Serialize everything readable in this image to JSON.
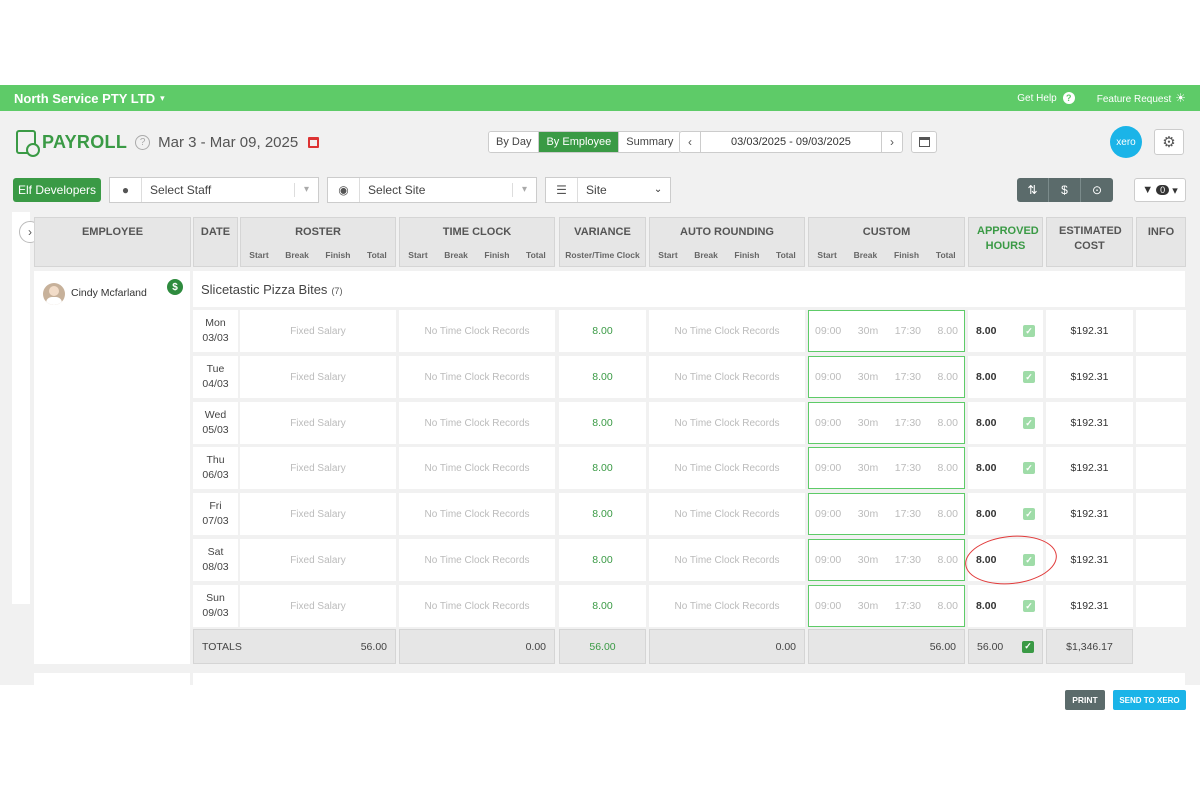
{
  "topbar": {
    "company": "North Service PTY LTD",
    "get_help": "Get Help",
    "feature_request": "Feature Request"
  },
  "header": {
    "title": "PAYROLL",
    "date_range_title": "Mar 3 - Mar 09, 2025",
    "views": [
      "By Day",
      "By Employee",
      "Summary"
    ],
    "active_view": "By Employee",
    "date_range": "03/03/2025 - 09/03/2025",
    "xero_label": "xero"
  },
  "filters": {
    "team": "Elf Developers",
    "staff_placeholder": "Select Staff",
    "site_placeholder": "Select Site",
    "group_by": "Site",
    "filter_count": "0"
  },
  "columns": {
    "employee": "EMPLOYEE",
    "date": "DATE",
    "roster": "ROSTER",
    "time_clock": "TIME CLOCK",
    "variance": "VARIANCE",
    "variance_sub": "Roster/Time Clock",
    "auto_rounding": "AUTO ROUNDING",
    "custom": "CUSTOM",
    "approved": "APPROVED HOURS",
    "cost": "ESTIMATED COST",
    "info": "INFO",
    "sub_start": "Start",
    "sub_break": "Break",
    "sub_finish": "Finish",
    "sub_total": "Total"
  },
  "employee": {
    "name": "Cindy Mcfarland",
    "site": "Slicetastic Pizza Bites",
    "site_count": "(7)"
  },
  "rows": [
    {
      "day": "Mon",
      "date": "03/03",
      "roster": "Fixed Salary",
      "clock": "No Time Clock Records",
      "variance": "8.00",
      "rounding": "No Time Clock Records",
      "c_start": "09:00",
      "c_break": "30m",
      "c_finish": "17:30",
      "c_total": "8.00",
      "approved": "8.00",
      "cost": "$192.31"
    },
    {
      "day": "Tue",
      "date": "04/03",
      "roster": "Fixed Salary",
      "clock": "No Time Clock Records",
      "variance": "8.00",
      "rounding": "No Time Clock Records",
      "c_start": "09:00",
      "c_break": "30m",
      "c_finish": "17:30",
      "c_total": "8.00",
      "approved": "8.00",
      "cost": "$192.31"
    },
    {
      "day": "Wed",
      "date": "05/03",
      "roster": "Fixed Salary",
      "clock": "No Time Clock Records",
      "variance": "8.00",
      "rounding": "No Time Clock Records",
      "c_start": "09:00",
      "c_break": "30m",
      "c_finish": "17:30",
      "c_total": "8.00",
      "approved": "8.00",
      "cost": "$192.31"
    },
    {
      "day": "Thu",
      "date": "06/03",
      "roster": "Fixed Salary",
      "clock": "No Time Clock Records",
      "variance": "8.00",
      "rounding": "No Time Clock Records",
      "c_start": "09:00",
      "c_break": "30m",
      "c_finish": "17:30",
      "c_total": "8.00",
      "approved": "8.00",
      "cost": "$192.31"
    },
    {
      "day": "Fri",
      "date": "07/03",
      "roster": "Fixed Salary",
      "clock": "No Time Clock Records",
      "variance": "8.00",
      "rounding": "No Time Clock Records",
      "c_start": "09:00",
      "c_break": "30m",
      "c_finish": "17:30",
      "c_total": "8.00",
      "approved": "8.00",
      "cost": "$192.31"
    },
    {
      "day": "Sat",
      "date": "08/03",
      "roster": "Fixed Salary",
      "clock": "No Time Clock Records",
      "variance": "8.00",
      "rounding": "No Time Clock Records",
      "c_start": "09:00",
      "c_break": "30m",
      "c_finish": "17:30",
      "c_total": "8.00",
      "approved": "8.00",
      "cost": "$192.31"
    },
    {
      "day": "Sun",
      "date": "09/03",
      "roster": "Fixed Salary",
      "clock": "No Time Clock Records",
      "variance": "8.00",
      "rounding": "No Time Clock Records",
      "c_start": "09:00",
      "c_break": "30m",
      "c_finish": "17:30",
      "c_total": "8.00",
      "approved": "8.00",
      "cost": "$192.31"
    }
  ],
  "totals": {
    "label": "TOTALS",
    "roster": "56.00",
    "clock": "0.00",
    "variance": "56.00",
    "rounding": "0.00",
    "custom": "56.00",
    "approved": "56.00",
    "cost": "$1,346.17"
  },
  "actions": {
    "print": "PRINT",
    "send_to_xero": "SEND TO XERO"
  },
  "colors": {
    "brand_green": "#5ecb68",
    "dark_green": "#3a9a45",
    "xero_blue": "#1ab4e8",
    "annotation_red": "#e13b3b"
  }
}
